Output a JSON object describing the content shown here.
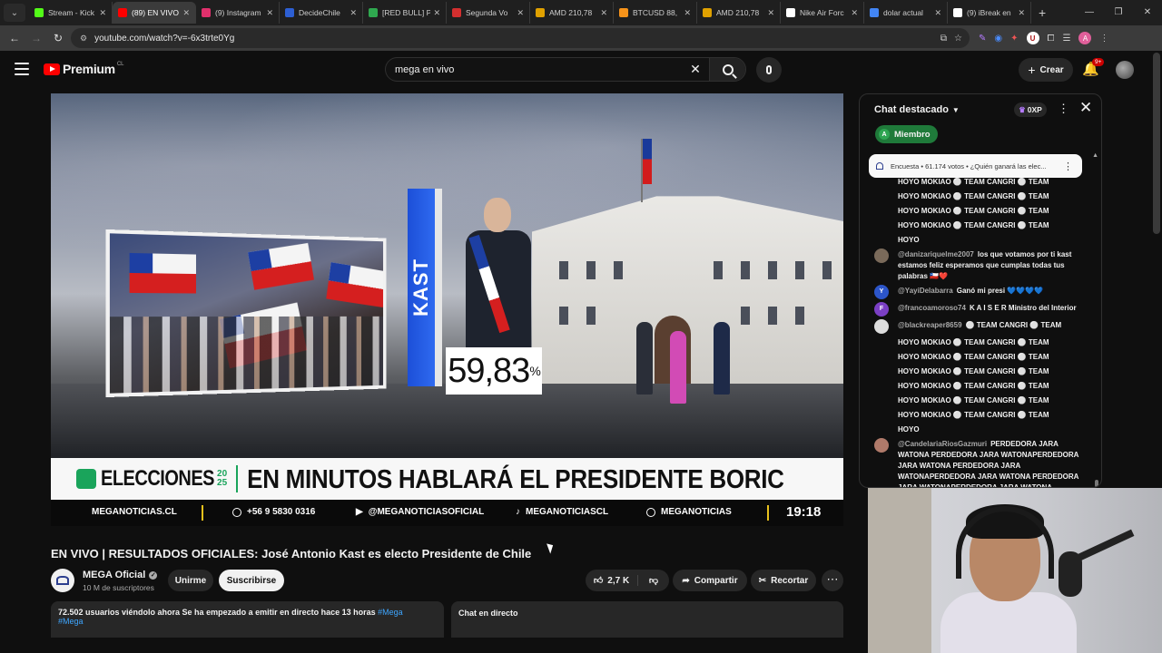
{
  "browser": {
    "tabs": [
      {
        "label": "Stream - Kick",
        "color": "#53fc18"
      },
      {
        "label": "(89) EN VIVO",
        "color": "#ff0000",
        "active": true
      },
      {
        "label": "(9) Instagram",
        "color": "#e1306c"
      },
      {
        "label": "DecideChile",
        "color": "#2d5fd3"
      },
      {
        "label": "[RED BULL] P",
        "color": "#2fa84f"
      },
      {
        "label": "Segunda Vo",
        "color": "#d32f2f"
      },
      {
        "label": "AMD 210,78",
        "color": "#e0a100"
      },
      {
        "label": "BTCUSD 88,",
        "color": "#f7931a"
      },
      {
        "label": "AMD 210,78",
        "color": "#e0a100"
      },
      {
        "label": "Nike Air Forc",
        "color": "#ffffff"
      },
      {
        "label": "dolar actual",
        "color": "#4285f4"
      },
      {
        "label": "(9) iBreak en",
        "color": "#ffffff"
      }
    ],
    "url": "youtube.com/watch?v=-6x3trte0Yg"
  },
  "youtube": {
    "brand": "Premium",
    "country": "CL",
    "search_query": "mega en vivo",
    "create_label": "Crear",
    "notif_badge": "9+"
  },
  "video": {
    "candidate_name": "KAST",
    "percentage": "59,83",
    "percent_sign": "%",
    "elecciones_label": "ELECCIONES",
    "year_top": "20",
    "year_bottom": "25",
    "headline": "EN MINUTOS HABLARÁ EL PRESIDENTE BORIC",
    "ticker": {
      "site": "MEGANOTICIAS.CL",
      "phone": "+56 9 5830 0316",
      "youtube": "@MEGANOTICIASOFICIAL",
      "social": "MEGANOTICIASCL",
      "spotify": "MEGANOTICIAS",
      "clock": "19:18"
    }
  },
  "info": {
    "title": "EN VIVO | RESULTADOS OFICIALES: José Antonio Kast es electo Presidente de Chile",
    "channel": "MEGA Oficial",
    "subscribers": "10 M de suscriptores",
    "join_label": "Unirme",
    "subscribe_label": "Suscribirse",
    "likes": "2,7 K",
    "share_label": "Compartir",
    "clip_label": "Recortar",
    "description": "72.502 usuarios viéndolo ahora  Se ha empezado a emitir en directo hace 13 horas",
    "tag1": "#Mega",
    "tag2": "#Mega",
    "live_chat_label": "Chat en directo"
  },
  "chat": {
    "header": "Chat destacado",
    "xp": "0XP",
    "member_label": "Miembro",
    "member_initial": "A",
    "poll_text": "Encuesta • 61.174 votos • ¿Quién ganará las elec...",
    "messages": [
      {
        "author": "",
        "text": "HOYO MOKIAO ⚪ TEAM CANGRI ⚪ TEAM",
        "cont": true
      },
      {
        "author": "",
        "text": "HOYO MOKIAO ⚪ TEAM CANGRI ⚪ TEAM",
        "cont": true
      },
      {
        "author": "",
        "text": "HOYO MOKIAO ⚪ TEAM CANGRI ⚪ TEAM",
        "cont": true
      },
      {
        "author": "",
        "text": "HOYO MOKIAO ⚪ TEAM CANGRI ⚪ TEAM",
        "cont": true
      },
      {
        "author": "",
        "text": "HOYO",
        "cont": true
      },
      {
        "author": "@danizariquelme2007",
        "text": "los que votamos por ti kast estamos feliz esperamos que cumplas todas tus palabras 🇨🇱❤️",
        "color": "#7a6a5a",
        "initial": ""
      },
      {
        "author": "@YayiDelabarra",
        "text": "Ganó mi presi 💙💙💙💙",
        "color": "#2c55c9",
        "initial": "Y"
      },
      {
        "author": "@francoamoroso74",
        "text": "K A I S E R Ministro del Interior",
        "color": "#7b3fc4",
        "initial": "F"
      },
      {
        "author": "@blackreaper8659",
        "text": "⚪ TEAM CANGRI ⚪ TEAM",
        "color": "#dddddd",
        "initial": ""
      },
      {
        "author": "",
        "text": "HOYO MOKIAO ⚪ TEAM CANGRI ⚪ TEAM",
        "cont": true
      },
      {
        "author": "",
        "text": "HOYO MOKIAO ⚪ TEAM CANGRI ⚪ TEAM",
        "cont": true
      },
      {
        "author": "",
        "text": "HOYO MOKIAO ⚪ TEAM CANGRI ⚪ TEAM",
        "cont": true
      },
      {
        "author": "",
        "text": "HOYO MOKIAO ⚪ TEAM CANGRI ⚪ TEAM",
        "cont": true
      },
      {
        "author": "",
        "text": "HOYO MOKIAO ⚪ TEAM CANGRI ⚪ TEAM",
        "cont": true
      },
      {
        "author": "",
        "text": "HOYO MOKIAO ⚪ TEAM CANGRI ⚪ TEAM",
        "cont": true
      },
      {
        "author": "",
        "text": "HOYO",
        "cont": true
      },
      {
        "author": "@CandelariaRiosGazmuri",
        "text": "PERDEDORA JARA WATONA PERDEDORA JARA WATONAPERDEDORA JARA WATONA PERDEDORA JARA WATONAPERDEDORA JARA WATONA PERDEDORA JARA WATONAPERDEDORA JARA WATONA",
        "color": "#b07a6a",
        "initial": ""
      }
    ]
  }
}
